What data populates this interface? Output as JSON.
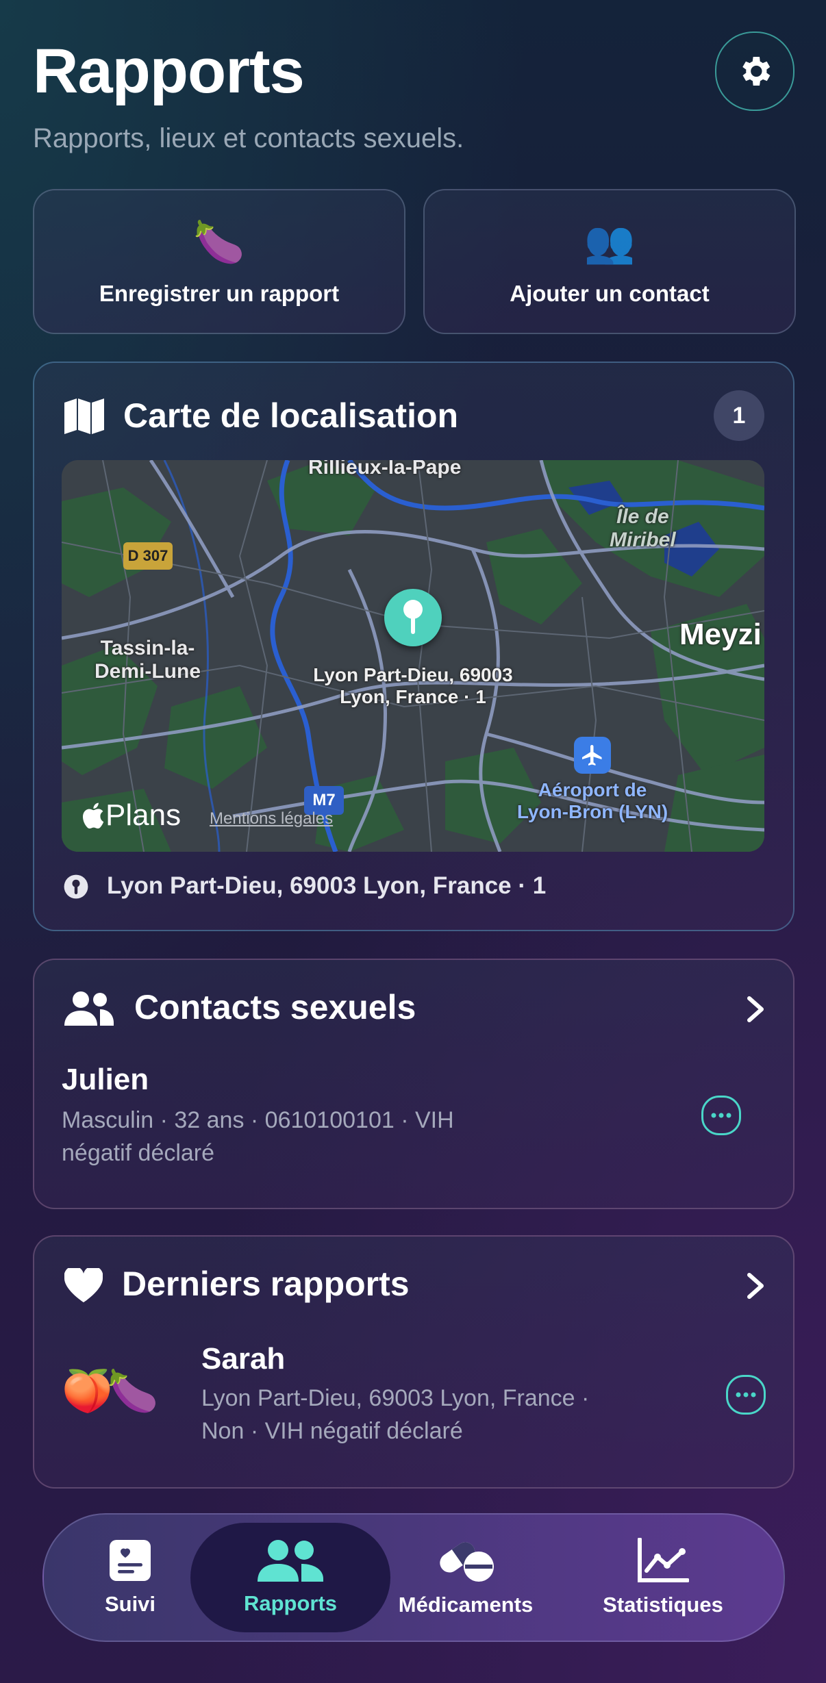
{
  "header": {
    "title": "Rapports",
    "subtitle": "Rapports, lieux et contacts sexuels."
  },
  "actions": [
    {
      "emoji": "🍆",
      "label": "Enregistrer un rapport"
    },
    {
      "emoji": "👥",
      "label": "Ajouter un contact"
    }
  ],
  "map_card": {
    "title": "Carte de localisation",
    "count": "1",
    "location": "Lyon Part-Dieu, 69003 Lyon, France · 1",
    "map": {
      "labels": {
        "rillieux": "Rillieux-la-Pape",
        "ile_miribel_1": "Île de",
        "ile_miribel_2": "Miribel",
        "d307": "D 307",
        "tassin_1": "Tassin-la-",
        "tassin_2": "Demi-Lune",
        "meyzieu": "Meyzi",
        "pin_1": "Lyon Part-Dieu, 69003",
        "pin_2": "Lyon, France · 1",
        "airport_1": "Aéroport de",
        "airport_2": "Lyon-Bron (LYN)",
        "m7": "M7",
        "plans": "Plans",
        "legal": "Mentions légales"
      }
    }
  },
  "contacts_card": {
    "title": "Contacts sexuels",
    "contact": {
      "name": "Julien",
      "details_1": "Masculin · 32 ans · 0610100101 · VIH",
      "details_2": "négatif déclaré"
    }
  },
  "reports_card": {
    "title": "Derniers rapports",
    "report": {
      "emojis": "🍑🍆",
      "name": "Sarah",
      "details_1": "Lyon Part-Dieu, 69003 Lyon, France ·",
      "details_2": "Non · VIH négatif déclaré"
    }
  },
  "tabbar": {
    "tabs": [
      {
        "label": "Suivi",
        "icon": "journal-icon"
      },
      {
        "label": "Rapports",
        "icon": "people-icon",
        "active": true
      },
      {
        "label": "Médicaments",
        "icon": "pills-icon"
      },
      {
        "label": "Statistiques",
        "icon": "chart-icon"
      }
    ]
  },
  "colors": {
    "accent": "#4ad6c8",
    "active_tab": "#1f1846"
  }
}
